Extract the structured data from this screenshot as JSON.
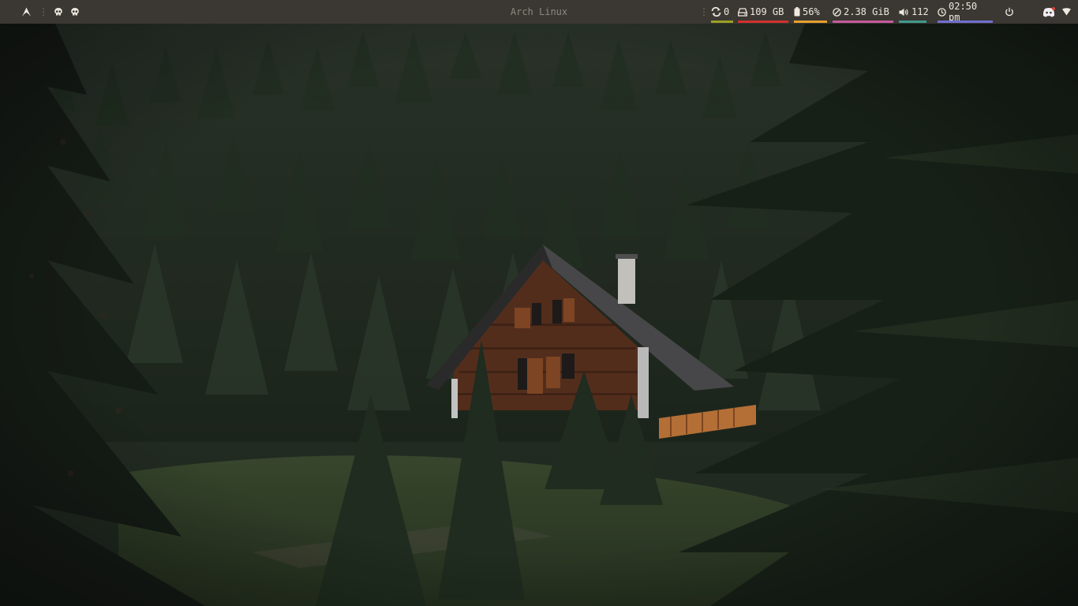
{
  "topbar": {
    "title": "Arch Linux",
    "updates": "0",
    "disk": "109 GB",
    "battery": "56%",
    "memory": "2.38 GiB",
    "volume": "112",
    "clock": "02:50 pm"
  },
  "colors": {
    "bar_bg": "#3b3733",
    "updates_accent": "#9aa023",
    "disk_accent": "#d0312b",
    "battery_accent": "#e5a02c",
    "memory_accent": "#c45a9b",
    "volume_accent": "#3e9b8c",
    "clock_accent": "#6f6fd0"
  },
  "icons": {
    "launcher": "arch-launcher-icon",
    "workspaces": [
      "skull-icon",
      "skull-icon"
    ],
    "updates": "refresh-icon",
    "disk": "harddisk-icon",
    "battery": "battery-icon",
    "memory": "memory-gauge-icon",
    "volume": "speaker-icon",
    "clock": "clock-icon",
    "power": "power-icon",
    "tray": [
      "discord-icon",
      "wifi-icon"
    ]
  },
  "wallpaper": "forest-cabin"
}
